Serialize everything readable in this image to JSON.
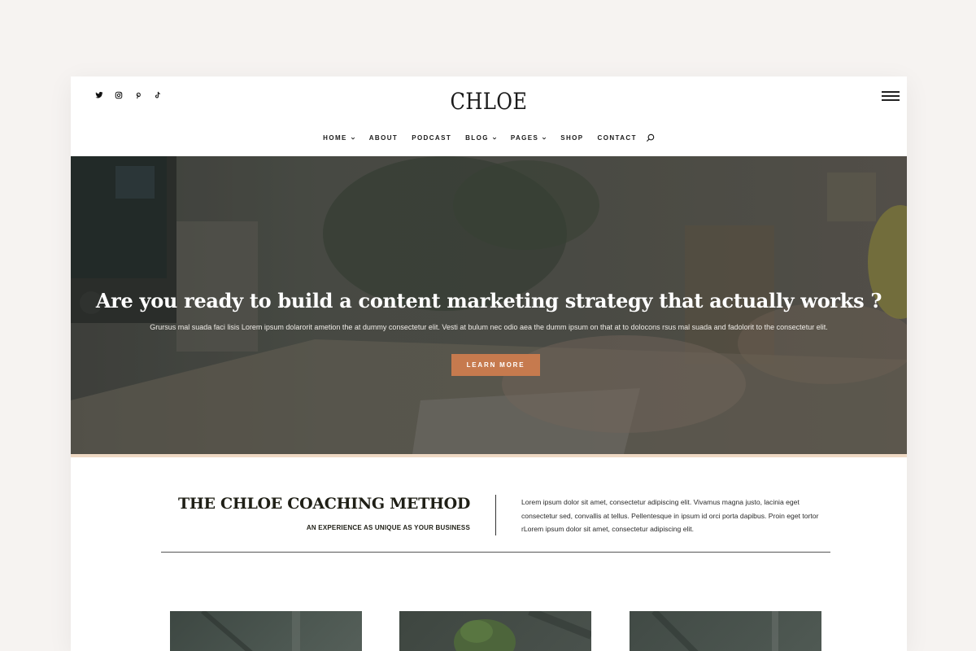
{
  "header": {
    "logo": "CHLOE",
    "socials": [
      "twitter-icon",
      "instagram-icon",
      "pinterest-icon",
      "tiktok-icon"
    ],
    "menu_icon": "hamburger-icon"
  },
  "nav": {
    "items": [
      {
        "label": "HOME",
        "has_dropdown": true
      },
      {
        "label": "ABOUT",
        "has_dropdown": false
      },
      {
        "label": "PODCAST",
        "has_dropdown": false
      },
      {
        "label": "BLOG",
        "has_dropdown": true
      },
      {
        "label": "PAGES",
        "has_dropdown": true
      },
      {
        "label": "SHOP",
        "has_dropdown": false
      },
      {
        "label": "CONTACT",
        "has_dropdown": false
      }
    ],
    "search_icon": "search-icon"
  },
  "hero": {
    "title": "Are you ready to build a content marketing strategy that actually works ?",
    "subtitle": "Grursus mal suada faci lisis Lorem ipsum dolarorit ametion the at dummy consectetur elit. Vesti at bulum nec odio aea the dumm ipsum on that at to dolocons rsus mal suada and fadolorit to the consectetur elit.",
    "button_label": "LEARN MORE"
  },
  "method": {
    "title": "THE CHLOE COACHING METHOD",
    "subtitle": "AN EXPERIENCE AS UNIQUE AS YOUR BUSINESS",
    "text": "Lorem ipsum dolor sit amet, consectetur adipiscing elit. Vivamus magna justo, lacinia eget consectetur sed, convallis at tellus. Pellentesque in ipsum id orci porta dapibus. Proin eget tortor rLorem ipsum dolor sit amet, consectetur adipiscing elit."
  },
  "colors": {
    "accent": "#c67a4e",
    "hero_border": "#efd9c4",
    "text_dark": "#1f1f16"
  }
}
